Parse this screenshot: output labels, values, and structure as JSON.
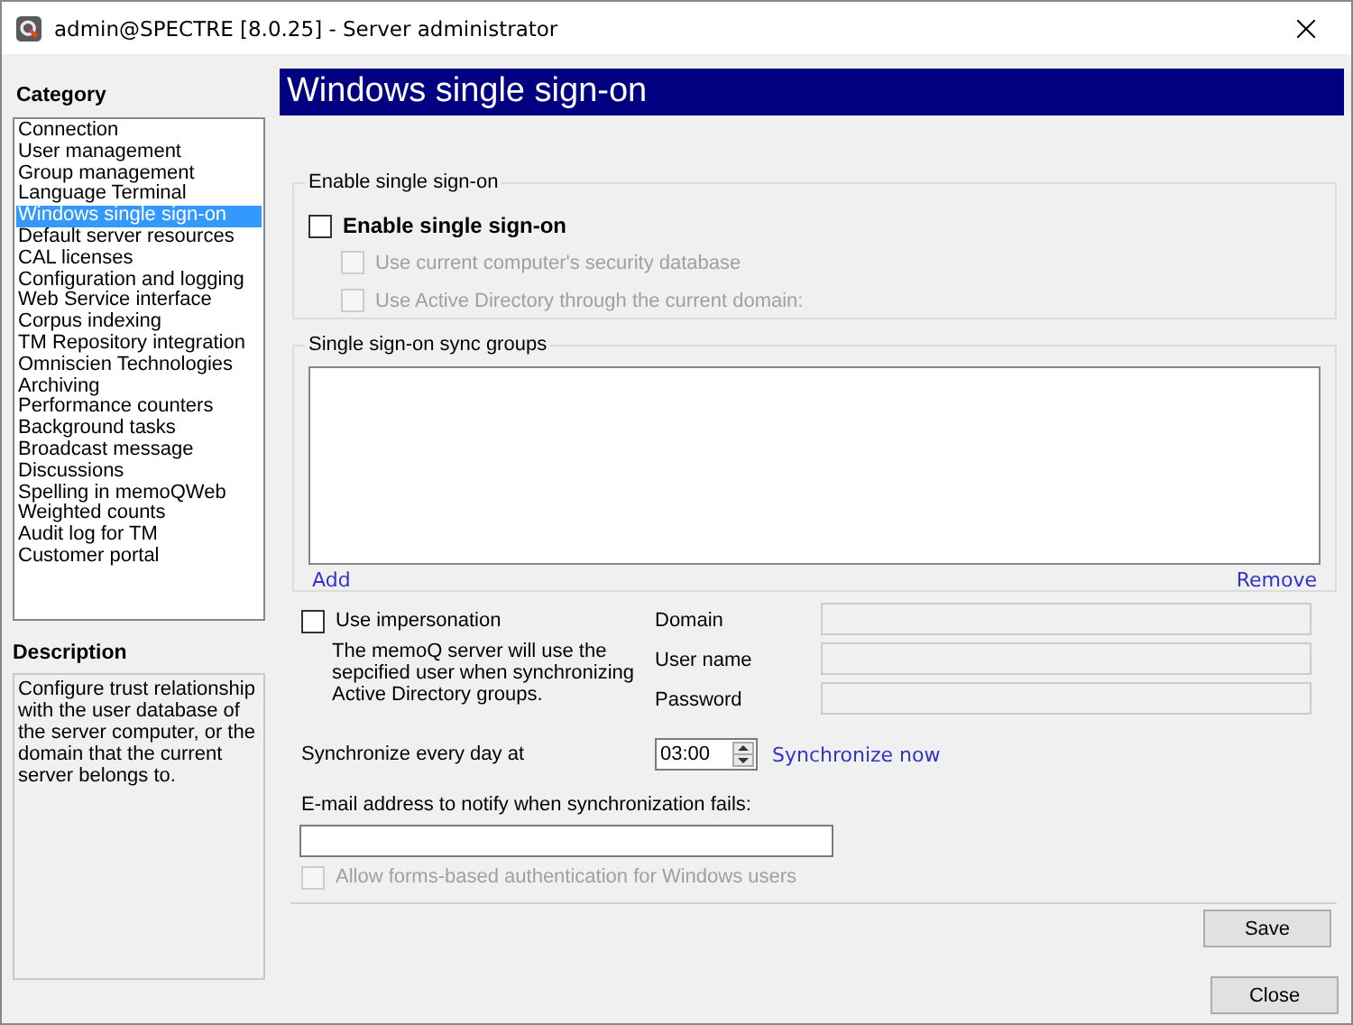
{
  "window": {
    "title": "admin@SPECTRE [8.0.25] - Server administrator"
  },
  "category": {
    "label": "Category",
    "items": [
      {
        "label": "Connection",
        "selected": false
      },
      {
        "label": "User management",
        "selected": false
      },
      {
        "label": "Group management",
        "selected": false
      },
      {
        "label": "Language Terminal",
        "selected": false
      },
      {
        "label": "Windows single sign-on",
        "selected": true
      },
      {
        "label": "Default server resources",
        "selected": false
      },
      {
        "label": "CAL licenses",
        "selected": false
      },
      {
        "label": "Configuration and logging",
        "selected": false
      },
      {
        "label": "Web Service interface",
        "selected": false
      },
      {
        "label": "Corpus indexing",
        "selected": false
      },
      {
        "label": "TM Repository integration",
        "selected": false
      },
      {
        "label": "Omniscien Technologies",
        "selected": false
      },
      {
        "label": "Archiving",
        "selected": false
      },
      {
        "label": "Performance counters",
        "selected": false
      },
      {
        "label": "Background tasks",
        "selected": false
      },
      {
        "label": "Broadcast message",
        "selected": false
      },
      {
        "label": "Discussions",
        "selected": false
      },
      {
        "label": "Spelling in memoQWeb",
        "selected": false
      },
      {
        "label": "Weighted counts",
        "selected": false
      },
      {
        "label": "Audit log for TM",
        "selected": false
      },
      {
        "label": "Customer portal",
        "selected": false
      }
    ]
  },
  "description": {
    "label": "Description",
    "text": "Configure trust relationship with the user database of the server computer, or the domain that the current server belongs to."
  },
  "page": {
    "title": "Windows single sign-on"
  },
  "sso_group": {
    "legend": "Enable single sign-on",
    "enable": {
      "label": "Enable single sign-on",
      "checked": false,
      "disabled": false
    },
    "options": [
      {
        "label": "Use current computer's security database",
        "checked": false,
        "disabled": true
      },
      {
        "label": "Use Active Directory through the current domain:",
        "checked": false,
        "disabled": true
      }
    ]
  },
  "sync_groups": {
    "legend": "Single sign-on sync groups",
    "add": "Add",
    "remove": "Remove"
  },
  "impersonation": {
    "label": "Use impersonation",
    "checked": false,
    "disabled": false,
    "note": "The memoQ server will use the sepcified user when synchronizing Active Directory groups.",
    "fields": [
      {
        "label": "Domain",
        "disabled": true
      },
      {
        "label": "User name",
        "disabled": true
      },
      {
        "label": "Password",
        "disabled": true
      }
    ]
  },
  "schedule": {
    "label": "Synchronize every day at",
    "time": "03:00",
    "sync_now": "Synchronize now"
  },
  "email": {
    "label": "E-mail address to notify when synchronization fails:"
  },
  "forms_auth": {
    "label": "Allow forms-based authentication for Windows users",
    "checked": false,
    "disabled": true
  },
  "buttons": {
    "save": "Save",
    "close": "Close"
  }
}
